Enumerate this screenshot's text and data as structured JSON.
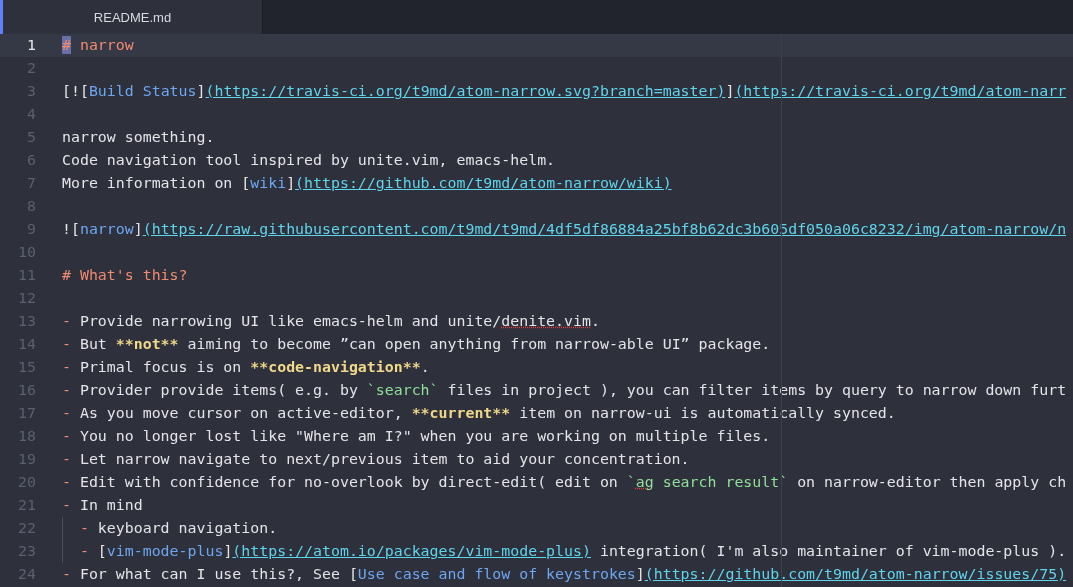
{
  "tabs": [
    {
      "label": "README.md",
      "selected": true
    }
  ],
  "lines": [
    {
      "number": "1",
      "current": true,
      "segments": [
        {
          "kind": "heading_selected",
          "text": "#"
        },
        {
          "kind": "heading",
          "text": " narrow"
        }
      ]
    },
    {
      "number": "2",
      "current": false
    },
    {
      "number": "3",
      "current": false,
      "segments": [
        {
          "kind": "text",
          "text": "[!["
        },
        {
          "kind": "link",
          "text": "Build Status"
        },
        {
          "kind": "text",
          "text": "]"
        },
        {
          "kind": "url",
          "text": "(https://travis-ci.org/t9md/atom-narrow.svg?branch=master)"
        },
        {
          "kind": "text",
          "text": "]"
        },
        {
          "kind": "url",
          "text": "(https://travis-ci.org/t9md/atom-narr"
        }
      ]
    },
    {
      "number": "4",
      "current": false
    },
    {
      "number": "5",
      "current": false,
      "segments": [
        {
          "kind": "text",
          "text": "narrow something."
        }
      ]
    },
    {
      "number": "6",
      "current": false,
      "segments": [
        {
          "kind": "text",
          "text": "Code navigation tool inspired by unite.vim, emacs-helm."
        }
      ]
    },
    {
      "number": "7",
      "current": false,
      "segments": [
        {
          "kind": "text",
          "text": "More information on ["
        },
        {
          "kind": "link",
          "text": "wiki"
        },
        {
          "kind": "text",
          "text": "]"
        },
        {
          "kind": "url",
          "text": "(https://github.com/t9md/atom-narrow/wiki)"
        }
      ]
    },
    {
      "number": "8",
      "current": false
    },
    {
      "number": "9",
      "current": false,
      "segments": [
        {
          "kind": "text",
          "text": "!["
        },
        {
          "kind": "link",
          "text": "narrow"
        },
        {
          "kind": "text",
          "text": "]"
        },
        {
          "kind": "url",
          "text": "(https://raw.githubusercontent.com/t9md/t9md/4df5df86884a25bf8b62dc3b605df050a06c8232/img/atom-narrow/n"
        }
      ]
    },
    {
      "number": "10",
      "current": false
    },
    {
      "number": "11",
      "current": false,
      "segments": [
        {
          "kind": "heading",
          "text": "# What's this?"
        }
      ]
    },
    {
      "number": "12",
      "current": false
    },
    {
      "number": "13",
      "current": false,
      "segments": [
        {
          "kind": "bullet",
          "text": "-"
        },
        {
          "kind": "text",
          "text": " Provide narrowing UI like emacs-helm and unite/"
        },
        {
          "kind": "misspelled",
          "text": "denite.vim"
        },
        {
          "kind": "text",
          "text": "."
        }
      ]
    },
    {
      "number": "14",
      "current": false,
      "segments": [
        {
          "kind": "bullet",
          "text": "-"
        },
        {
          "kind": "text",
          "text": " But "
        },
        {
          "kind": "bold",
          "text": "**not**"
        },
        {
          "kind": "text",
          "text": " aiming to become ”can open anything from narrow-able UI” package."
        }
      ]
    },
    {
      "number": "15",
      "current": false,
      "segments": [
        {
          "kind": "bullet",
          "text": "-"
        },
        {
          "kind": "text",
          "text": " Primal focus is on "
        },
        {
          "kind": "bold",
          "text": "**code-navigation**"
        },
        {
          "kind": "text",
          "text": "."
        }
      ]
    },
    {
      "number": "16",
      "current": false,
      "segments": [
        {
          "kind": "bullet",
          "text": "-"
        },
        {
          "kind": "text",
          "text": " Provider provide items( e.g. by "
        },
        {
          "kind": "code",
          "text": "`search`"
        },
        {
          "kind": "text",
          "text": " files in project ), you can filter items by query to narrow down furt"
        }
      ]
    },
    {
      "number": "17",
      "current": false,
      "segments": [
        {
          "kind": "bullet",
          "text": "-"
        },
        {
          "kind": "text",
          "text": " As you move cursor on active-editor, "
        },
        {
          "kind": "bold",
          "text": "**current**"
        },
        {
          "kind": "text",
          "text": " item on narrow-ui is automatically synced."
        }
      ]
    },
    {
      "number": "18",
      "current": false,
      "segments": [
        {
          "kind": "bullet",
          "text": "-"
        },
        {
          "kind": "text",
          "text": " You no longer lost like \"Where am I?\" when you are working on multiple files."
        }
      ]
    },
    {
      "number": "19",
      "current": false,
      "segments": [
        {
          "kind": "bullet",
          "text": "-"
        },
        {
          "kind": "text",
          "text": " Let narrow navigate to next/previous item to aid your concentration."
        }
      ]
    },
    {
      "number": "20",
      "current": false,
      "segments": [
        {
          "kind": "bullet",
          "text": "-"
        },
        {
          "kind": "text",
          "text": " Edit with confidence for no-overlook by direct-edit( edit on "
        },
        {
          "kind": "code",
          "text": "`"
        },
        {
          "kind": "code_misspelled",
          "text": "ag"
        },
        {
          "kind": "code",
          "text": " search result`"
        },
        {
          "kind": "text",
          "text": " on narrow-editor then apply ch"
        }
      ]
    },
    {
      "number": "21",
      "current": false,
      "segments": [
        {
          "kind": "bullet",
          "text": "-"
        },
        {
          "kind": "text",
          "text": " In mind"
        }
      ]
    },
    {
      "number": "22",
      "current": false,
      "segments": [
        {
          "kind": "indent"
        },
        {
          "kind": "bullet",
          "text": "-"
        },
        {
          "kind": "text",
          "text": " keyboard navigation."
        }
      ]
    },
    {
      "number": "23",
      "current": false,
      "segments": [
        {
          "kind": "indent"
        },
        {
          "kind": "bullet",
          "text": "-"
        },
        {
          "kind": "text",
          "text": " ["
        },
        {
          "kind": "link",
          "text": "vim-mode-plus"
        },
        {
          "kind": "text",
          "text": "]"
        },
        {
          "kind": "url",
          "text": "(https://atom.io/packages/vim-mode-plus)"
        },
        {
          "kind": "text",
          "text": " integration( I'm also maintainer of vim-mode-plus )."
        }
      ]
    },
    {
      "number": "24",
      "current": false,
      "segments": [
        {
          "kind": "bullet",
          "text": "-"
        },
        {
          "kind": "text",
          "text": " For what can I use this?, See ["
        },
        {
          "kind": "link",
          "text": "Use case and flow of keystrokes"
        },
        {
          "kind": "text",
          "text": "]"
        },
        {
          "kind": "url",
          "text": "(https://github.com/t9md/atom-narrow/issues/75)"
        }
      ]
    }
  ]
}
